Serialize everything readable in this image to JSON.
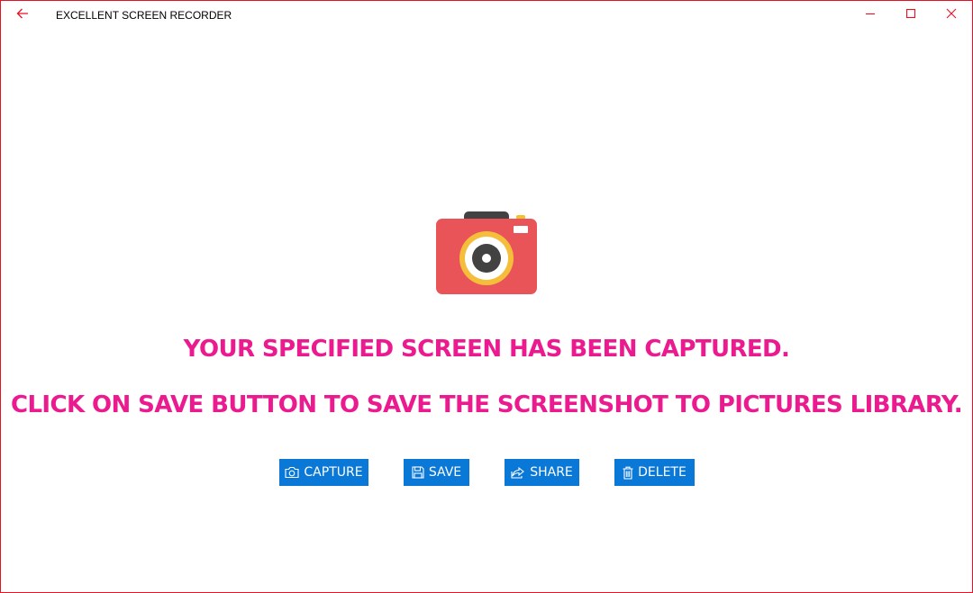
{
  "window": {
    "title": "EXCELLENT SCREEN RECORDER",
    "accent_color": "#e81123",
    "controls": [
      "back-arrow-icon",
      "minimize-icon",
      "maximize-icon",
      "close-icon"
    ]
  },
  "main": {
    "illustration": "camera-icon",
    "message_line1": "YOUR SPECIFIED SCREEN HAS BEEN CAPTURED.",
    "message_line2": "CLICK ON SAVE BUTTON TO SAVE THE SCREENSHOT TO PICTURES LIBRARY.",
    "message_color": "#ec1a8f"
  },
  "actions": {
    "button_color": "#0a78d7",
    "capture_label": "CAPTURE",
    "save_label": "SAVE",
    "share_label": "SHARE",
    "delete_label": "DELETE"
  }
}
